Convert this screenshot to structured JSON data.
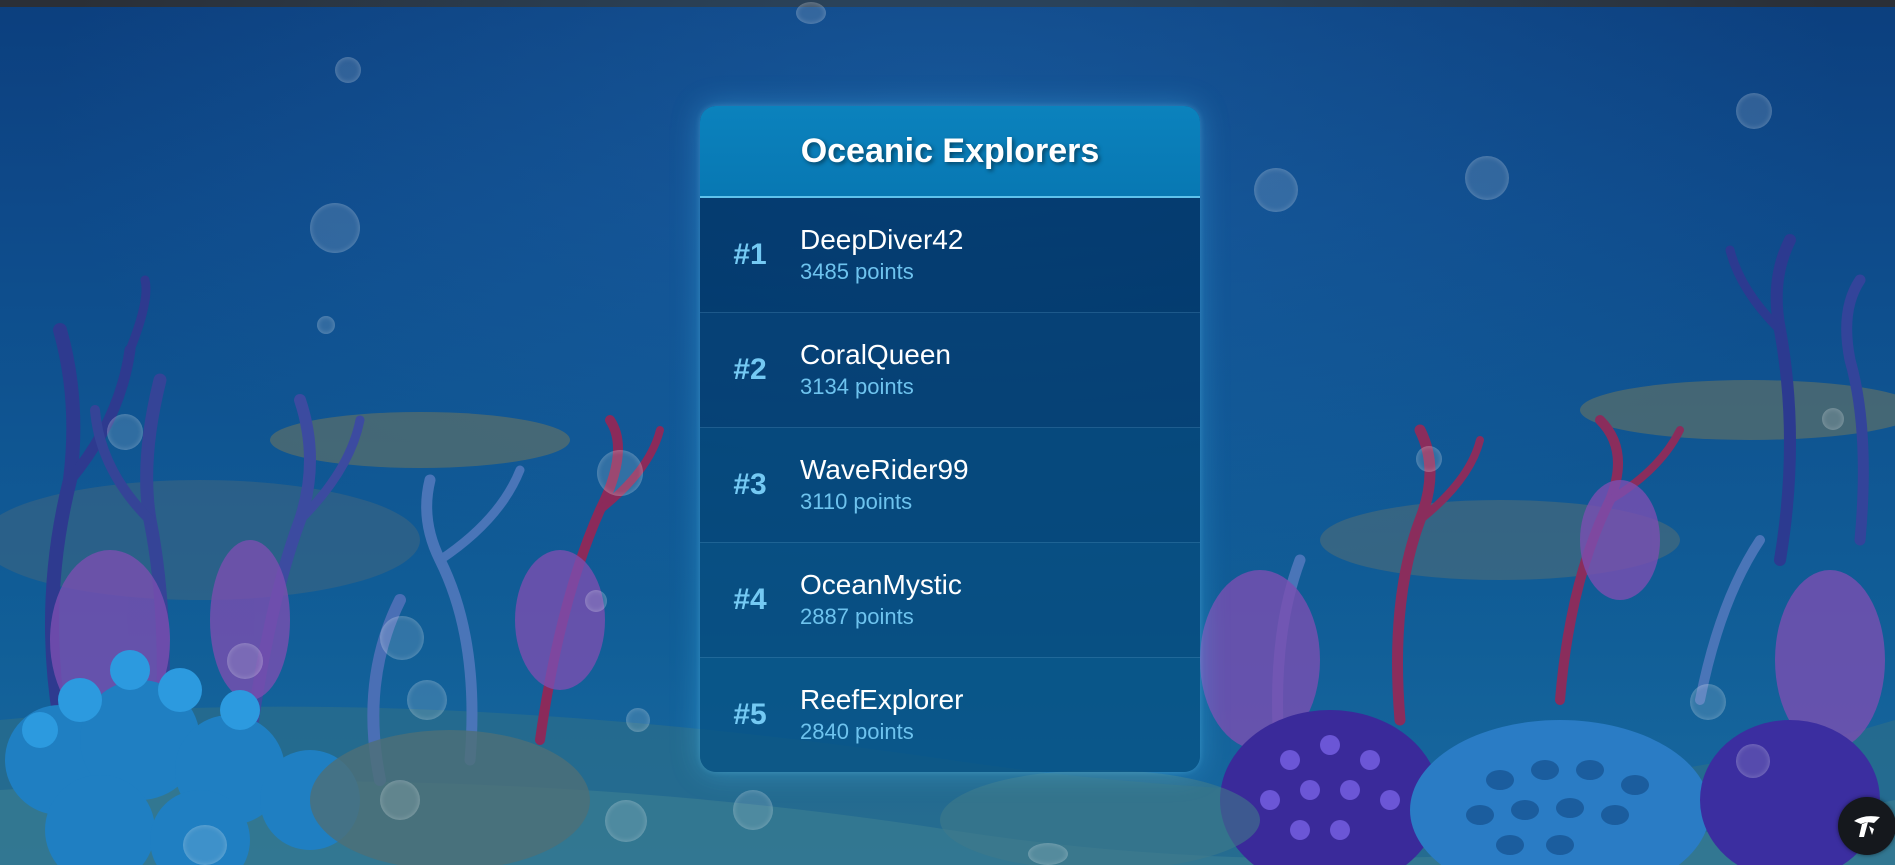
{
  "leaderboard": {
    "title": "Oceanic Explorers",
    "entries": [
      {
        "rank": "#1",
        "name": "DeepDiver42",
        "points": "3485 points"
      },
      {
        "rank": "#2",
        "name": "CoralQueen",
        "points": "3134 points"
      },
      {
        "rank": "#3",
        "name": "WaveRider99",
        "points": "3110 points"
      },
      {
        "rank": "#4",
        "name": "OceanMystic",
        "points": "2887 points"
      },
      {
        "rank": "#5",
        "name": "ReefExplorer",
        "points": "2840 points"
      }
    ]
  },
  "background": {
    "scene": "underwater coral reef",
    "colors": {
      "deep": "#0c3f7e",
      "mid": "#0f5592",
      "shallow": "#1a6aa0"
    }
  },
  "corner_widget": {
    "icon": "assistant-logo-icon"
  },
  "colors": {
    "header": "#0b82bd",
    "rank_text": "#74c9f3",
    "points_text": "#6ec3ee",
    "name_text": "#ffffff"
  }
}
